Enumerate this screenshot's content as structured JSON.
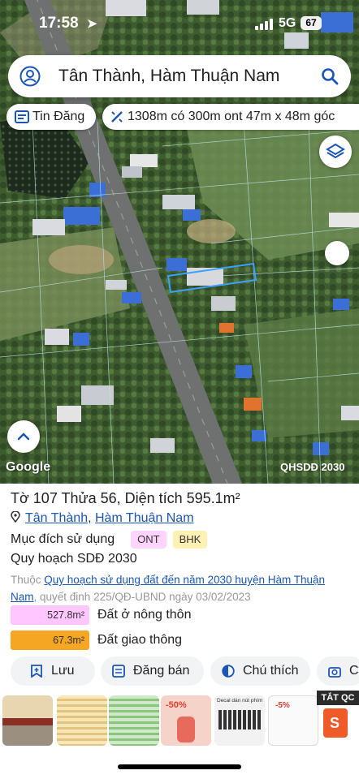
{
  "status": {
    "time": "17:58",
    "network": "5G",
    "battery": "67"
  },
  "search": {
    "value": "Tân Thành, Hàm Thuận Nam"
  },
  "chips": {
    "news": "Tin Đăng",
    "measure": "1308m có 300m ont 47m x 48m góc"
  },
  "map": {
    "logo": "Google",
    "credit": "QHSDĐ 2030"
  },
  "parcel": {
    "title": "Tờ 107 Thửa 56, Diện tích 595.1m²",
    "commune": "Tân Thành",
    "district": "Hàm Thuận Nam",
    "separator": ", ",
    "purpose_label": "Mục đích sử dụng",
    "badges": [
      "ONT",
      "BHK"
    ],
    "plan_title": "Quy hoạch SDĐ 2030",
    "plan_prefix": "Thuộc ",
    "plan_link": "Quy hoạch sử dụng đất đến năm 2030 huyện Hàm Thuận Nam",
    "plan_suffix": ", quyết định 225/QĐ-UBND ngày 03/02/2023",
    "areas": [
      {
        "value": "527.8m²",
        "label": "Đất ở nông thôn",
        "color": "#ffc6ff"
      },
      {
        "value": "67.3m²",
        "label": "Đất giao thông",
        "color": "#f5a623"
      }
    ]
  },
  "actions": {
    "save": "Lưu",
    "sell": "Đăng bán",
    "legend": "Chú thích",
    "capture": "Ch"
  },
  "ad": {
    "close_label": "TẮT QC",
    "thumb_texts": [
      "-50%",
      "-5%",
      "Decal dán nút phím"
    ]
  },
  "colors": {
    "accent": "#1a56b6",
    "parcel_outline": "#3aa0ff"
  }
}
